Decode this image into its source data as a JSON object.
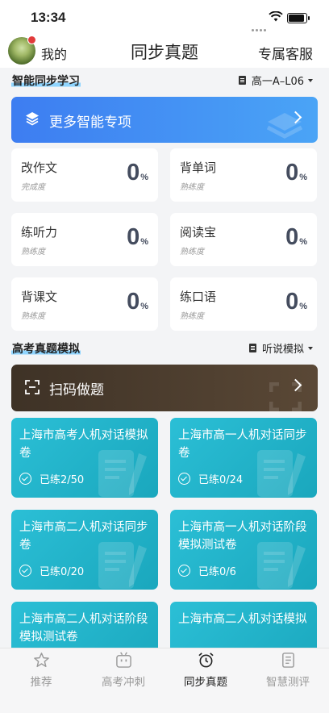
{
  "status_bar": {
    "time": "13:34"
  },
  "header": {
    "me_label": "我的",
    "title": "同步真题",
    "service_label": "专属客服"
  },
  "sync_section": {
    "title": "智能同步学习",
    "selector": "高一A–L06",
    "banner_label": "更多智能专项",
    "stats": [
      {
        "name": "改作文",
        "sub": "完成度",
        "value": "0",
        "unit": "%"
      },
      {
        "name": "背单词",
        "sub": "熟练度",
        "value": "0",
        "unit": "%"
      },
      {
        "name": "练听力",
        "sub": "熟练度",
        "value": "0",
        "unit": "%"
      },
      {
        "name": "阅读宝",
        "sub": "熟练度",
        "value": "0",
        "unit": "%"
      },
      {
        "name": "背课文",
        "sub": "熟练度",
        "value": "0",
        "unit": "%"
      },
      {
        "name": "练口语",
        "sub": "熟练度",
        "value": "0",
        "unit": "%"
      }
    ]
  },
  "exam_section": {
    "title": "高考真题模拟",
    "selector": "听说模拟",
    "banner_label": "扫码做题",
    "papers": [
      {
        "name": "上海市高考人机对话模拟卷",
        "progress": "已练2/50"
      },
      {
        "name": "上海市高一人机对话同步卷",
        "progress": "已练0/24"
      },
      {
        "name": "上海市高二人机对话同步卷",
        "progress": "已练0/20"
      },
      {
        "name": "上海市高一人机对话阶段模拟测试卷",
        "progress": "已练0/6"
      },
      {
        "name": "上海市高二人机对话阶段模拟测试卷",
        "progress": ""
      },
      {
        "name": "上海市高二人机对话模拟",
        "progress": ""
      }
    ]
  },
  "tabbar": {
    "tabs": [
      {
        "label": "推荐",
        "icon": "star-icon"
      },
      {
        "label": "高考冲刺",
        "icon": "robot-icon"
      },
      {
        "label": "同步真题",
        "icon": "alarm-clock-icon"
      },
      {
        "label": "智慧测评",
        "icon": "document-icon"
      }
    ],
    "active": "同步真题"
  },
  "colors": {
    "accent_blue": "#3d7df1",
    "card_teal": "#22b4ca",
    "scan_brown": "#4a3c2e"
  }
}
